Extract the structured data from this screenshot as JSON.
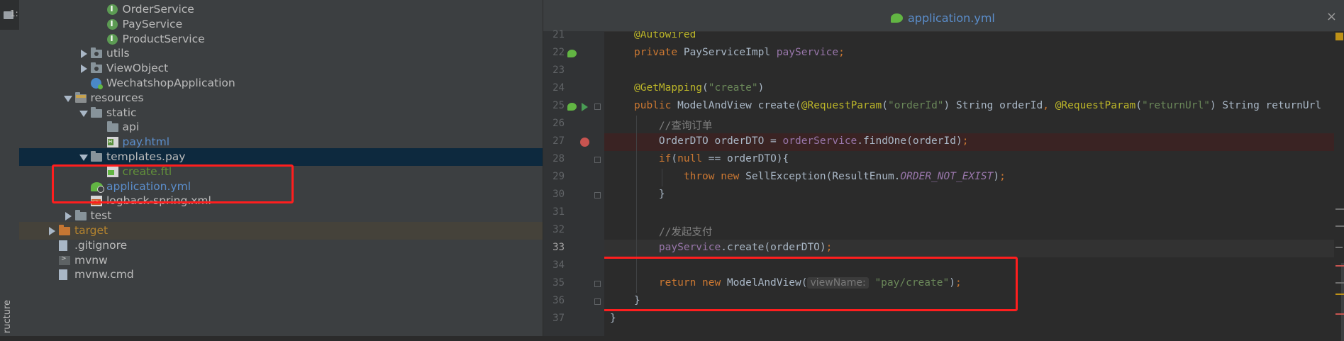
{
  "left_strip": {
    "top_text": "1:",
    "bottom_text": "ructure"
  },
  "project_tree": [
    {
      "label": "OrderService",
      "icon": "interface-icon",
      "indent": 3,
      "arrow": "none",
      "color": "default"
    },
    {
      "label": "PayService",
      "icon": "interface-icon",
      "indent": 3,
      "arrow": "none",
      "color": "default"
    },
    {
      "label": "ProductService",
      "icon": "interface-icon",
      "indent": 3,
      "arrow": "none",
      "color": "default"
    },
    {
      "label": "utils",
      "icon": "package-folder-icon",
      "indent": 2,
      "arrow": "right",
      "color": "default"
    },
    {
      "label": "ViewObject",
      "icon": "package-folder-icon",
      "indent": 2,
      "arrow": "right",
      "color": "default"
    },
    {
      "label": "WechatshopApplication",
      "icon": "spring-class-icon",
      "indent": 2,
      "arrow": "none",
      "color": "default"
    },
    {
      "label": "resources",
      "icon": "resources-folder-icon",
      "indent": 1,
      "arrow": "down",
      "color": "default"
    },
    {
      "label": "static",
      "icon": "folder-icon",
      "indent": 2,
      "arrow": "down",
      "color": "default"
    },
    {
      "label": "api",
      "icon": "folder-icon",
      "indent": 3,
      "arrow": "none",
      "color": "default"
    },
    {
      "label": "pay.html",
      "icon": "html-file-icon",
      "indent": 3,
      "arrow": "none",
      "color": "blue"
    },
    {
      "label": "templates.pay",
      "icon": "folder-icon",
      "indent": 2,
      "arrow": "down",
      "color": "default",
      "selected": true
    },
    {
      "label": "create.ftl",
      "icon": "ftl-file-icon",
      "indent": 3,
      "arrow": "none",
      "color": "green"
    },
    {
      "label": "application.yml",
      "icon": "yml-file-icon",
      "indent": 2,
      "arrow": "none",
      "color": "blue"
    },
    {
      "label": "logback-spring.xml",
      "icon": "xml-file-icon",
      "indent": 2,
      "arrow": "none",
      "color": "default"
    },
    {
      "label": "test",
      "icon": "folder-icon",
      "indent": 1,
      "arrow": "right",
      "color": "default"
    },
    {
      "label": "target",
      "icon": "excluded-folder-icon",
      "indent": 0,
      "arrow": "right",
      "color": "orange",
      "highlight": true
    },
    {
      "label": ".gitignore",
      "icon": "text-file-icon",
      "indent": 0,
      "arrow": "none",
      "color": "default"
    },
    {
      "label": "mvnw",
      "icon": "terminal-file-icon",
      "indent": 0,
      "arrow": "none",
      "color": "default"
    },
    {
      "label": "mvnw.cmd",
      "icon": "text-file-icon",
      "indent": 0,
      "arrow": "none",
      "color": "default"
    }
  ],
  "editor": {
    "active_tab": "application.yml",
    "close_glyph": "×",
    "line_numbers": [
      "21",
      "22",
      "23",
      "24",
      "25",
      "26",
      "27",
      "28",
      "29",
      "30",
      "31",
      "32",
      "33",
      "34",
      "35",
      "36",
      "37"
    ],
    "code_lines": [
      [
        {
          "t": "@Autowired",
          "c": "ann"
        }
      ],
      [
        {
          "t": "private ",
          "c": "kw"
        },
        {
          "t": "PayServiceImpl ",
          "c": ""
        },
        {
          "t": "payService",
          "c": "fld"
        },
        {
          "t": ";",
          "c": "kw"
        }
      ],
      [],
      [
        {
          "t": "@GetMapping",
          "c": "ann"
        },
        {
          "t": "(",
          "c": ""
        },
        {
          "t": "\"create\"",
          "c": "str"
        },
        {
          "t": ")",
          "c": ""
        }
      ],
      [
        {
          "t": "public ",
          "c": "kw"
        },
        {
          "t": "ModelAndView ",
          "c": ""
        },
        {
          "t": "create",
          "c": "fn"
        },
        {
          "t": "(",
          "c": ""
        },
        {
          "t": "@RequestParam",
          "c": "ann"
        },
        {
          "t": "(",
          "c": ""
        },
        {
          "t": "\"orderId\"",
          "c": "str"
        },
        {
          "t": ") String orderId",
          "c": ""
        },
        {
          "t": ", ",
          "c": "kw"
        },
        {
          "t": "@RequestParam",
          "c": "ann"
        },
        {
          "t": "(",
          "c": ""
        },
        {
          "t": "\"returnUrl\"",
          "c": "str"
        },
        {
          "t": ") String returnUrl",
          "c": ""
        }
      ],
      [
        {
          "t": "    //查询订单",
          "c": "cmt"
        }
      ],
      [
        {
          "t": "    OrderDTO orderDTO = ",
          "c": ""
        },
        {
          "t": "orderService",
          "c": "fld"
        },
        {
          "t": ".findOne(orderId)",
          "c": ""
        },
        {
          "t": ";",
          "c": "kw"
        }
      ],
      [
        {
          "t": "    ",
          "c": ""
        },
        {
          "t": "if",
          "c": "kw"
        },
        {
          "t": "(",
          "c": ""
        },
        {
          "t": "null",
          "c": "kw"
        },
        {
          "t": " == orderDTO){",
          "c": ""
        }
      ],
      [
        {
          "t": "        ",
          "c": ""
        },
        {
          "t": "throw new ",
          "c": "kw"
        },
        {
          "t": "SellException(ResultEnum.",
          "c": ""
        },
        {
          "t": "ORDER_NOT_EXIST",
          "c": "ifld"
        },
        {
          "t": ")",
          "c": ""
        },
        {
          "t": ";",
          "c": "kw"
        }
      ],
      [
        {
          "t": "    }",
          "c": ""
        }
      ],
      [],
      [
        {
          "t": "    //发起支付",
          "c": "cmt"
        }
      ],
      [
        {
          "t": "    ",
          "c": ""
        },
        {
          "t": "payService",
          "c": "fld"
        },
        {
          "t": ".create(orderDTO)",
          "c": ""
        },
        {
          "t": ";",
          "c": "kw"
        }
      ],
      [],
      [
        {
          "t": "    ",
          "c": ""
        },
        {
          "t": "return new ",
          "c": "kw"
        },
        {
          "t": "ModelAndView(",
          "c": ""
        },
        {
          "t": "viewName:",
          "c": "hint"
        },
        {
          "t": " ",
          "c": ""
        },
        {
          "t": "\"pay/create\"",
          "c": "str"
        },
        {
          "t": ")",
          "c": ""
        },
        {
          "t": ";",
          "c": "kw"
        }
      ],
      [
        {
          "t": "}",
          "c": ""
        }
      ],
      [
        {
          "t": "}",
          "c": "",
          "outdent": true
        }
      ]
    ]
  },
  "colors": {
    "accent_red_box": "#ff1e1e",
    "selection": "#0d293e",
    "keyword": "#cc7832",
    "annotation": "#bbb529",
    "string": "#6a8759",
    "field": "#9876aa"
  }
}
